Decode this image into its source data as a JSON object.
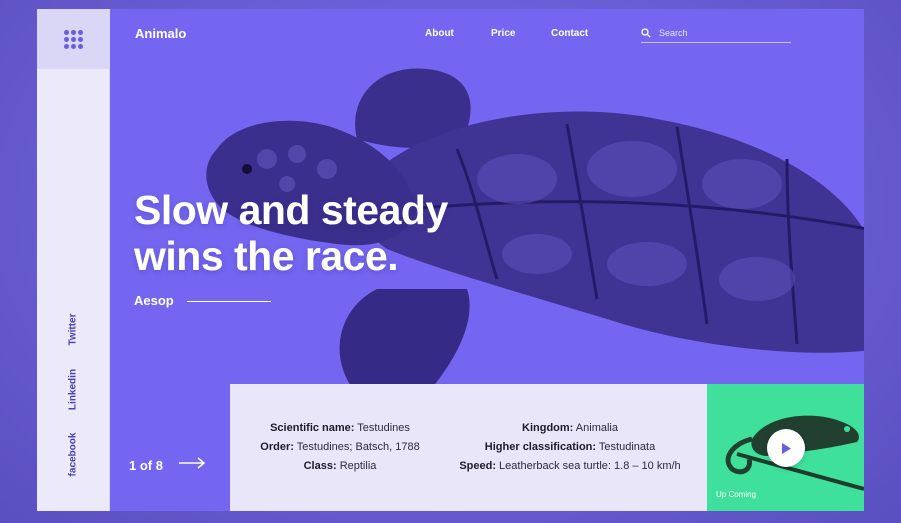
{
  "brand": {
    "name": "Animalo"
  },
  "nav": {
    "items": [
      {
        "label": "About"
      },
      {
        "label": "Price"
      },
      {
        "label": "Contact"
      }
    ]
  },
  "search": {
    "placeholder": "Search",
    "icon": "search-icon"
  },
  "social": {
    "links": [
      {
        "label": "Twitter"
      },
      {
        "label": "Linkedin"
      },
      {
        "label": "facebook"
      }
    ]
  },
  "hero": {
    "headline_line1": "Slow and steady",
    "headline_line2": "wins the race.",
    "author": "Aesop"
  },
  "pager": {
    "current": "1 of 8"
  },
  "info": {
    "left": [
      {
        "label": "Scientific name:",
        "value": " Testudines"
      },
      {
        "label": "Order:",
        "value": " Testudines; Batsch, 1788"
      },
      {
        "label": "Class:",
        "value": " Reptilia"
      }
    ],
    "right": [
      {
        "label": "Kingdom:",
        "value": " Animalia"
      },
      {
        "label": "Higher classification:",
        "value": " Testudinata"
      },
      {
        "label": "Speed:",
        "value": " Leatherback sea turtle: 1.8 – 10 km/h"
      }
    ]
  },
  "upcoming": {
    "label": "Up Coming"
  },
  "colors": {
    "background": "#6a5ec9",
    "hero": "#7466f0",
    "sidebar": "#ebe9fa",
    "card": "#e8e6f8",
    "upcoming": "#3fe09c",
    "turtle": "#3a2f8c"
  }
}
